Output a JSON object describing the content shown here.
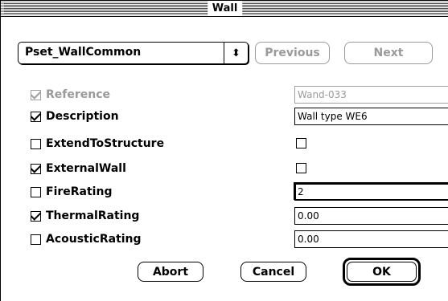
{
  "window": {
    "title": "Wall"
  },
  "pset_popup": {
    "selected": "Pset_WallCommon",
    "arrow_glyph": "⬍"
  },
  "nav": {
    "previous_label": "Previous",
    "next_label": "Next"
  },
  "properties": [
    {
      "label": "Reference",
      "checked": true,
      "enabled": false,
      "value_type": "text",
      "value": "Wand-033"
    },
    {
      "label": "Description",
      "checked": true,
      "enabled": true,
      "value_type": "text",
      "value": "Wall type WE6"
    },
    {
      "label": "ExtendToStructure",
      "checked": false,
      "enabled": true,
      "value_type": "bool",
      "value": false
    },
    {
      "label": "ExternalWall",
      "checked": true,
      "enabled": true,
      "value_type": "bool",
      "value": false
    },
    {
      "label": "FireRating",
      "checked": false,
      "enabled": true,
      "value_type": "text",
      "value": "2"
    },
    {
      "label": "ThermalRating",
      "checked": true,
      "enabled": true,
      "value_type": "text",
      "value": "0.00"
    },
    {
      "label": "AcousticRating",
      "checked": false,
      "enabled": true,
      "value_type": "text",
      "value": "0.00"
    }
  ],
  "buttons": {
    "abort_label": "Abort",
    "cancel_label": "Cancel",
    "ok_label": "OK"
  }
}
